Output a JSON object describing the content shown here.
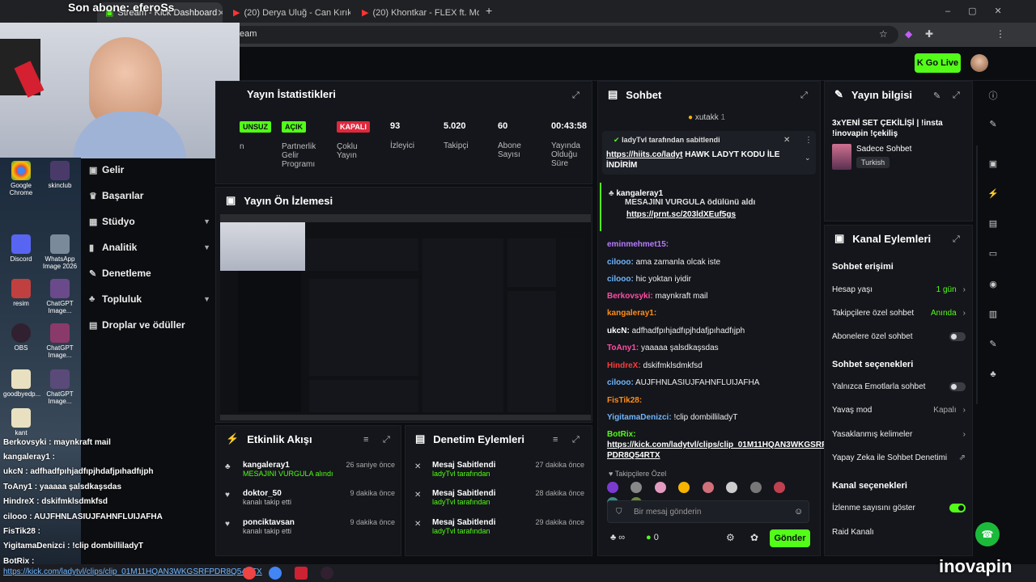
{
  "browser": {
    "tabs": [
      {
        "label": "Stream - Kick Dashboard"
      },
      {
        "label": "(20) Derya Uluğ - Can Kırıkl"
      },
      {
        "label": "(20) Khontkar - FLEX ft. Motive"
      }
    ],
    "new_tab": "+",
    "address": "eam"
  },
  "overlay": {
    "sub_text": "Son abone: eferoSs"
  },
  "header": {
    "go_live": "Go Live"
  },
  "nav": {
    "items": [
      {
        "label": "Gelir"
      },
      {
        "label": "Başarılar"
      },
      {
        "label": "Stüdyo"
      },
      {
        "label": "Analitik"
      },
      {
        "label": "Denetleme"
      },
      {
        "label": "Topluluk"
      },
      {
        "label": "Droplar ve ödüller"
      }
    ]
  },
  "stats": {
    "title": "Yayın İstatistikleri",
    "items": [
      {
        "badge": "UNSUZ",
        "label": "n"
      },
      {
        "badge": "AÇIK",
        "label": "Partnerlik Gelir Programı"
      },
      {
        "badge": "KAPALI",
        "label": "Çoklu Yayın"
      },
      {
        "value": "93",
        "label": "İzleyici"
      },
      {
        "value": "5.020",
        "label": "Takipçi"
      },
      {
        "value": "60",
        "label": "Abone Sayısı"
      },
      {
        "value": "00:43:58",
        "label": "Yayında Olduğu Süre"
      }
    ]
  },
  "preview": {
    "title": "Yayın Ön İzlemesi"
  },
  "feed": {
    "title": "Etkinlik Akışı",
    "items": [
      {
        "name": "kangaleray1",
        "sub": "MESAJINI VURGULA alındı",
        "time": "26 saniye önce"
      },
      {
        "name": "doktor_50",
        "sub": "kanalı takip etti",
        "time": "9 dakika önce"
      },
      {
        "name": "ponciktavsan",
        "sub": "kanalı takip etti",
        "time": "9 dakika önce"
      }
    ]
  },
  "moderation": {
    "title": "Denetim Eylemleri",
    "items": [
      {
        "name": "Mesaj Sabitlendi",
        "sub": "ladyTvl tarafından",
        "time": "27 dakika önce"
      },
      {
        "name": "Mesaj Sabitlendi",
        "sub": "ladyTvl tarafından",
        "time": "28 dakika önce"
      },
      {
        "name": "Mesaj Sabitlendi",
        "sub": "ladyTvl tarafından",
        "time": "29 dakika önce"
      }
    ]
  },
  "chat": {
    "title": "Sohbet",
    "top_user": "xutakk",
    "top_count": "1",
    "pinned_by": "ladyTvl tarafından sabitlendi",
    "pinned_link": "https://hiits.co/ladyt",
    "pinned_text": "HAWK LADYT KODU İLE",
    "pinned_text2": "İNDİRİM",
    "reward_user": "kangaleray1",
    "reward_text": "MESAJINI VURGULA ödülünü aldı",
    "reward_link": "https://prnt.sc/203ldXEuf5gs",
    "messages": [
      {
        "user": "eminmehmet15:",
        "text": "",
        "color": "#b77bff"
      },
      {
        "user": "cilooo:",
        "text": "ama zamanla olcak iste",
        "color": "#6fb6ff"
      },
      {
        "user": "cilooo:",
        "text": "hic yoktan iyidir",
        "color": "#6fb6ff"
      },
      {
        "user": "Berkovsyki:",
        "text": "maynkraft mail",
        "color": "#ff4da6"
      },
      {
        "user": "kangaleray1:",
        "text": "",
        "color": "#ff8c1a"
      },
      {
        "user": "ukcN:",
        "text": "adfhadfpıhjadfıpjhdafjpıhadfıjph",
        "color": "#ffffff"
      },
      {
        "user": "ToAny1:",
        "text": "yaaaaa şalsdkaşsdas",
        "color": "#ff4da6"
      },
      {
        "user": "HindreX:",
        "text": "dskifmklsdmkfsd",
        "color": "#ff3b3b"
      },
      {
        "user": "cilooo:",
        "text": "AUJFHNLASIUJFAHNFLUIJAFHA",
        "color": "#6fb6ff"
      },
      {
        "user": "FisTik28:",
        "text": "",
        "color": "#ff8c1a"
      },
      {
        "user": "YigitamaDenizci:",
        "text": "!clip dombilliladyT",
        "color": "#6fb6ff"
      },
      {
        "user": "BotRix:",
        "text": "",
        "color": "#53fc18"
      }
    ],
    "botrix_link": "https://kick.com/ladytvl/clips/clip_01M11HQAN3WKGSRF",
    "botrix_link2": "PDR8Q54RTX",
    "followers_label": "Takipçilere Özel",
    "input_placeholder": "Bir mesaj gönderin",
    "infinity": "∞",
    "points": "0",
    "send": "Gönder"
  },
  "info": {
    "title": "Yayın bilgisi",
    "stream_title": "3xYENİ SET ÇEKİLİŞİ | !insta !inovapin !çekiliş",
    "category": "Sadece Sohbet",
    "language": "Turkish"
  },
  "actions": {
    "title": "Kanal Eylemleri",
    "chat_access": "Sohbet erişimi",
    "account_age": "Hesap yaşı",
    "account_age_val": "1 gün",
    "follower_chat": "Takipçilere özel sohbet",
    "follower_chat_val": "Anında",
    "sub_chat": "Abonelere özel sohbet",
    "chat_options": "Sohbet seçenekleri",
    "emote_only": "Yalnızca Emotlarla sohbet",
    "slow_mode": "Yavaş mod",
    "slow_mode_val": "Kapalı",
    "banned_words": "Yasaklanmış kelimeler",
    "ai_mod": "Yapay Zeka ile Sohbet Denetimi",
    "channel_options": "Kanal seçenekleri",
    "show_viewers": "İzlenme sayısını göster",
    "raid": "Raid Kanalı"
  },
  "desktop": {
    "icons": [
      {
        "label": "Google Chrome"
      },
      {
        "label": "skinclub"
      },
      {
        "label": "Discord"
      },
      {
        "label": "WhatsApp Image 2026"
      },
      {
        "label": "resim"
      },
      {
        "label": "ChatGPT Image..."
      },
      {
        "label": "OBS"
      },
      {
        "label": "ChatGPT Image..."
      },
      {
        "label": "goodbyedp..."
      },
      {
        "label": "ChatGPT Image..."
      },
      {
        "label": "kant"
      }
    ],
    "overlay_chat": [
      {
        "text": "Berkovsyki : maynkraft mail"
      },
      {
        "text": "kangaleray1 :"
      },
      {
        "text": "ukcN : adfhadfpıhjadfıpjhdafjpıhadfıjph"
      },
      {
        "text": "ToAny1 : yaaaaa şalsdkaşsdas"
      },
      {
        "text": "HindreX : dskifmklsdmkfsd"
      },
      {
        "text": "cilooo : AUJFHNLASIUJFAHNFLUIJAFHA"
      },
      {
        "text": "FisTik28 :"
      },
      {
        "text": "YigitamaDenizci : !clip dombilliladyT"
      },
      {
        "text": "BotRix :"
      }
    ],
    "overlay_link": "https://kick.com/ladytvl/clips/clip_01M11HQAN3WKGSRFPDR8Q54RTX",
    "brand": "inovapin"
  },
  "colors": {
    "accent": "#53fc18",
    "panel": "#14161b",
    "bg": "#0b0d10"
  }
}
